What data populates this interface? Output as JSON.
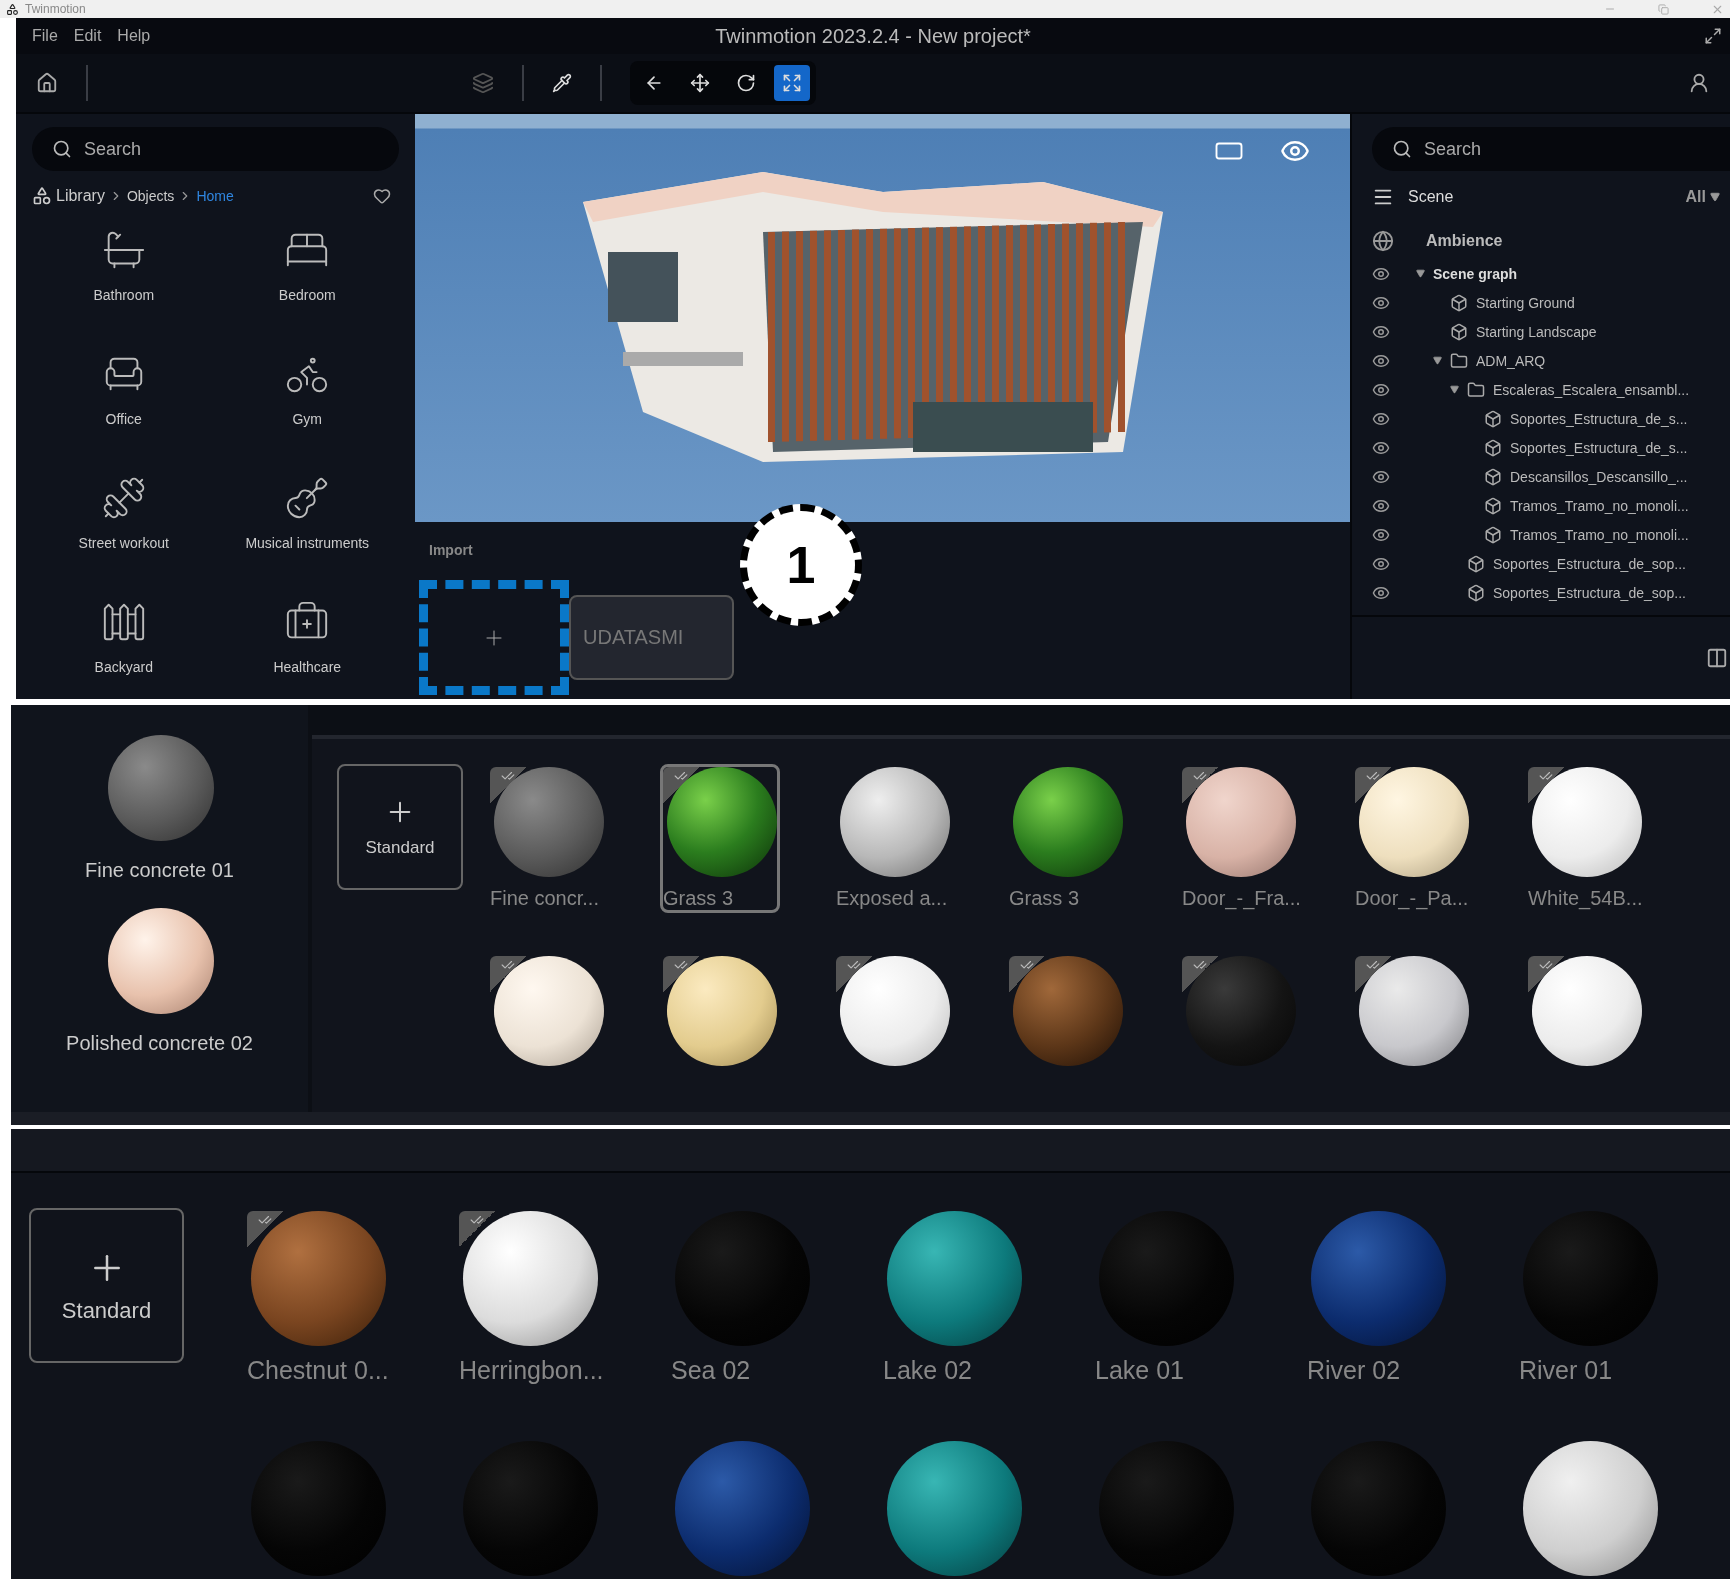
{
  "window": {
    "app_name": "Twinmotion",
    "title": "Twinmotion 2023.2.4 - New project*"
  },
  "menu": [
    "File",
    "Edit",
    "Help"
  ],
  "toolbar": {
    "tools": [
      {
        "kind": "back",
        "selected": false
      },
      {
        "kind": "move",
        "selected": false
      },
      {
        "kind": "orbit",
        "selected": false
      },
      {
        "kind": "scale",
        "selected": true
      }
    ]
  },
  "library": {
    "search_placeholder": "Search",
    "breadcrumb": [
      {
        "label": "Library",
        "selected": false
      },
      {
        "label": "Objects",
        "selected": false
      },
      {
        "label": "Home",
        "selected": true
      }
    ],
    "categories": [
      {
        "label": "Bathroom",
        "kind": "bath"
      },
      {
        "label": "Bedroom",
        "kind": "bed"
      },
      {
        "label": "Office",
        "kind": "office"
      },
      {
        "label": "Gym",
        "kind": "bike"
      },
      {
        "label": "Street workout",
        "kind": "bars"
      },
      {
        "label": "Musical instruments",
        "kind": "guitar"
      },
      {
        "label": "Backyard",
        "kind": "fence"
      },
      {
        "label": "Healthcare",
        "kind": "medkit"
      }
    ]
  },
  "import": {
    "label": "Import",
    "card_label": "UDATASMI",
    "badge": "1"
  },
  "scene": {
    "search_placeholder": "Search",
    "title": "Scene",
    "filter": "All",
    "ambience": "Ambience",
    "tree": [
      {
        "label": "Scene graph",
        "kind": "root",
        "expanded": true,
        "children": [
          {
            "label": "Starting Ground",
            "kind": "object"
          },
          {
            "label": "Starting Landscape",
            "kind": "object"
          },
          {
            "label": "ADM_ARQ",
            "kind": "folder",
            "expanded": true,
            "children": [
              {
                "label": "Escaleras_Escalera_ensambl...",
                "kind": "folder",
                "expanded": true,
                "children": [
                  {
                    "label": "Soportes_Estructura_de_s...",
                    "kind": "object"
                  },
                  {
                    "label": "Soportes_Estructura_de_s...",
                    "kind": "object"
                  },
                  {
                    "label": "Descansillos_Descansillo_...",
                    "kind": "object"
                  },
                  {
                    "label": "Tramos_Tramo_no_monoli...",
                    "kind": "object"
                  },
                  {
                    "label": "Tramos_Tramo_no_monoli...",
                    "kind": "object"
                  }
                ]
              },
              {
                "label": "Soportes_Estructura_de_sop...",
                "kind": "object"
              },
              {
                "label": "Soportes_Estructura_de_sop...",
                "kind": "object"
              }
            ]
          }
        ]
      }
    ]
  },
  "materials_panel": {
    "recent": [
      {
        "label": "Fine concrete 01",
        "kind": "grey"
      },
      {
        "label": "Polished concrete 02",
        "kind": "peach"
      }
    ],
    "add_label": "Standard",
    "rows": [
      [
        {
          "label": "Fine concr...",
          "kind": "grey",
          "checked": true,
          "selected": false
        },
        {
          "label": "Grass 3",
          "kind": "grass",
          "checked": true,
          "selected": true
        },
        {
          "label": "Exposed a...",
          "kind": "spotted",
          "checked": false,
          "selected": false
        },
        {
          "label": "Grass 3",
          "kind": "grass",
          "checked": false,
          "selected": false
        },
        {
          "label": "Door_-_Fra...",
          "kind": "pink",
          "checked": true,
          "selected": false
        },
        {
          "label": "Door_-_Pa...",
          "kind": "cream",
          "checked": true,
          "selected": false
        },
        {
          "label": "White_54B...",
          "kind": "white",
          "checked": true,
          "selected": false
        }
      ],
      [
        {
          "kind": "ivory",
          "checked": true,
          "selected": false
        },
        {
          "kind": "wood",
          "checked": true,
          "selected": false
        },
        {
          "kind": "white",
          "checked": true,
          "selected": false
        },
        {
          "kind": "soil",
          "checked": true,
          "selected": false
        },
        {
          "kind": "black",
          "checked": true,
          "selected": false
        },
        {
          "kind": "silver",
          "checked": true,
          "selected": false
        },
        {
          "kind": "white",
          "checked": true,
          "selected": false
        }
      ]
    ]
  },
  "water_panel": {
    "add_label": "Standard",
    "rows": [
      [
        {
          "label": "Chestnut 0...",
          "kind": "chestnut",
          "checked": true
        },
        {
          "label": "Herringbon...",
          "kind": "marble",
          "checked": true
        },
        {
          "label": "Sea 02",
          "kind": "gloss",
          "checked": false
        },
        {
          "label": "Lake 02",
          "kind": "teal",
          "checked": false
        },
        {
          "label": "Lake 01",
          "kind": "gloss",
          "checked": false
        },
        {
          "label": "River 02",
          "kind": "navy",
          "checked": false
        },
        {
          "label": "River 01",
          "kind": "gloss",
          "checked": false
        }
      ],
      [
        {
          "kind": "gloss",
          "checked": false
        },
        {
          "kind": "gloss",
          "checked": false
        },
        {
          "kind": "navy",
          "checked": false
        },
        {
          "kind": "teal",
          "checked": false
        },
        {
          "kind": "gloss",
          "checked": false
        },
        {
          "kind": "gloss",
          "checked": false
        },
        {
          "kind": "stone",
          "checked": false
        }
      ]
    ]
  }
}
